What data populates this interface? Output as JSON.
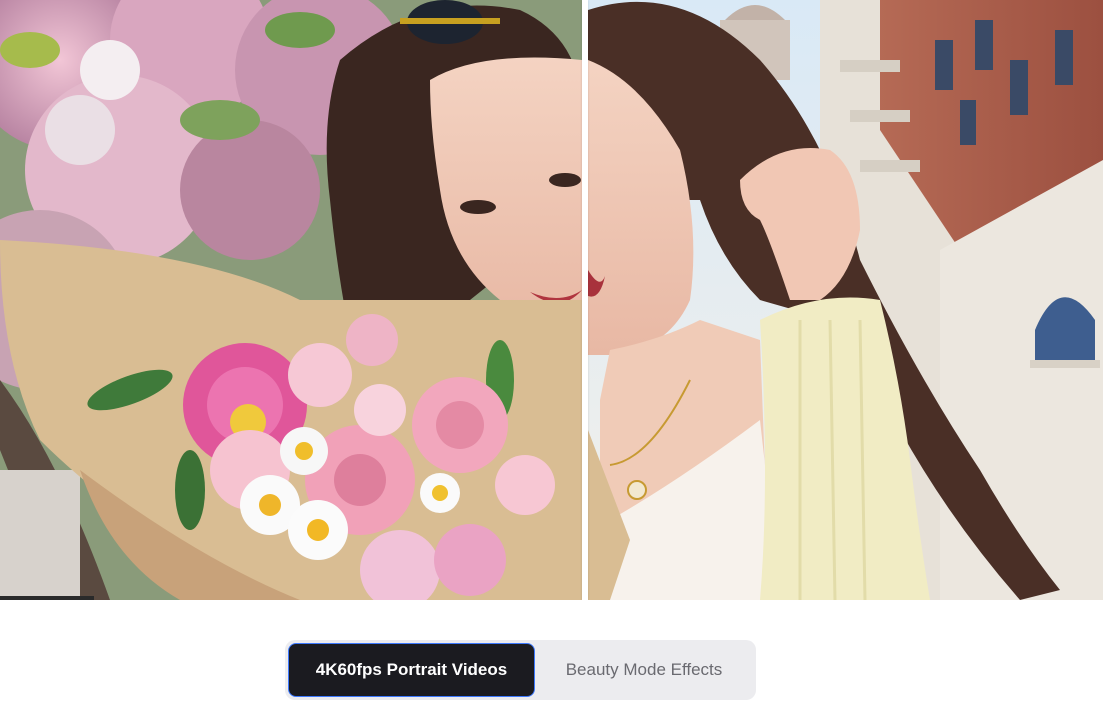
{
  "hero": {
    "left_label": "",
    "right_label": ""
  },
  "tabs": [
    {
      "label": "4K60fps Portrait Videos",
      "active": true
    },
    {
      "label": "Beauty Mode Effects",
      "active": false
    }
  ],
  "colors": {
    "active_tab_bg": "#1b1b20",
    "active_tab_border": "#3d79ff",
    "inactive_tab_text": "#6a6a70",
    "toggle_bg": "#ececef"
  }
}
